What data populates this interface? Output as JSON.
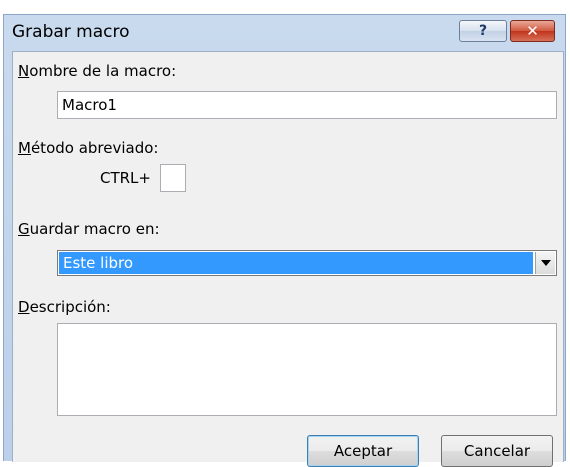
{
  "window": {
    "title": "Grabar macro",
    "help_glyph": "?",
    "close_glyph": "✕"
  },
  "macro_name": {
    "label_mnemonic": "N",
    "label_rest": "ombre de la macro:",
    "value": "Macro1"
  },
  "shortcut": {
    "label_mnemonic": "M",
    "label_rest": "étodo abreviado:",
    "prefix": "CTRL+",
    "value": ""
  },
  "store_in": {
    "label_mnemonic": "G",
    "label_rest": "uardar macro en:",
    "selected": "Este libro"
  },
  "description": {
    "label_mnemonic": "D",
    "label_rest": "escripción:",
    "value": ""
  },
  "buttons": {
    "ok": "Aceptar",
    "cancel": "Cancelar"
  },
  "colors": {
    "selection": "#3399ff",
    "close_button": "#c1341b",
    "title_bar": "#c9daee"
  }
}
